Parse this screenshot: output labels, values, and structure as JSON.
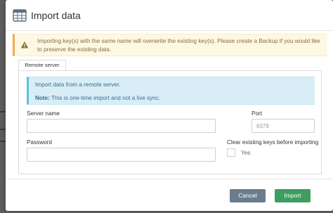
{
  "dialog": {
    "title": "Import data",
    "icon": "table-icon"
  },
  "warning": {
    "icon": "warning-icon",
    "text": "Importing key(s) with the same name will overwrite the existing key(s). Please create a Backup if you would like to preserve the existing data."
  },
  "tabs": [
    {
      "label": "Remote server",
      "active": true
    }
  ],
  "info": {
    "line1": "Import data from a remote server.",
    "note_label": "Note:",
    "note_text": " This is one-time import and not a live sync."
  },
  "form": {
    "server_name": {
      "label": "Server name",
      "value": "",
      "placeholder": ""
    },
    "port": {
      "label": "Port",
      "value": "",
      "placeholder": "6379"
    },
    "password": {
      "label": "Password",
      "value": "",
      "placeholder": ""
    },
    "clear_keys": {
      "label": "Clear existing keys before importing",
      "option": "Yes",
      "checked": false
    }
  },
  "buttons": {
    "cancel": "Cancel",
    "import": "Import"
  },
  "colors": {
    "warning_bg": "#fcf8e3",
    "warning_accent": "#f0ad4e",
    "info_bg": "#d9edf7",
    "info_accent": "#5bc0de",
    "cancel_button": "#6b7d8c",
    "import_button": "#3d9e5f"
  }
}
